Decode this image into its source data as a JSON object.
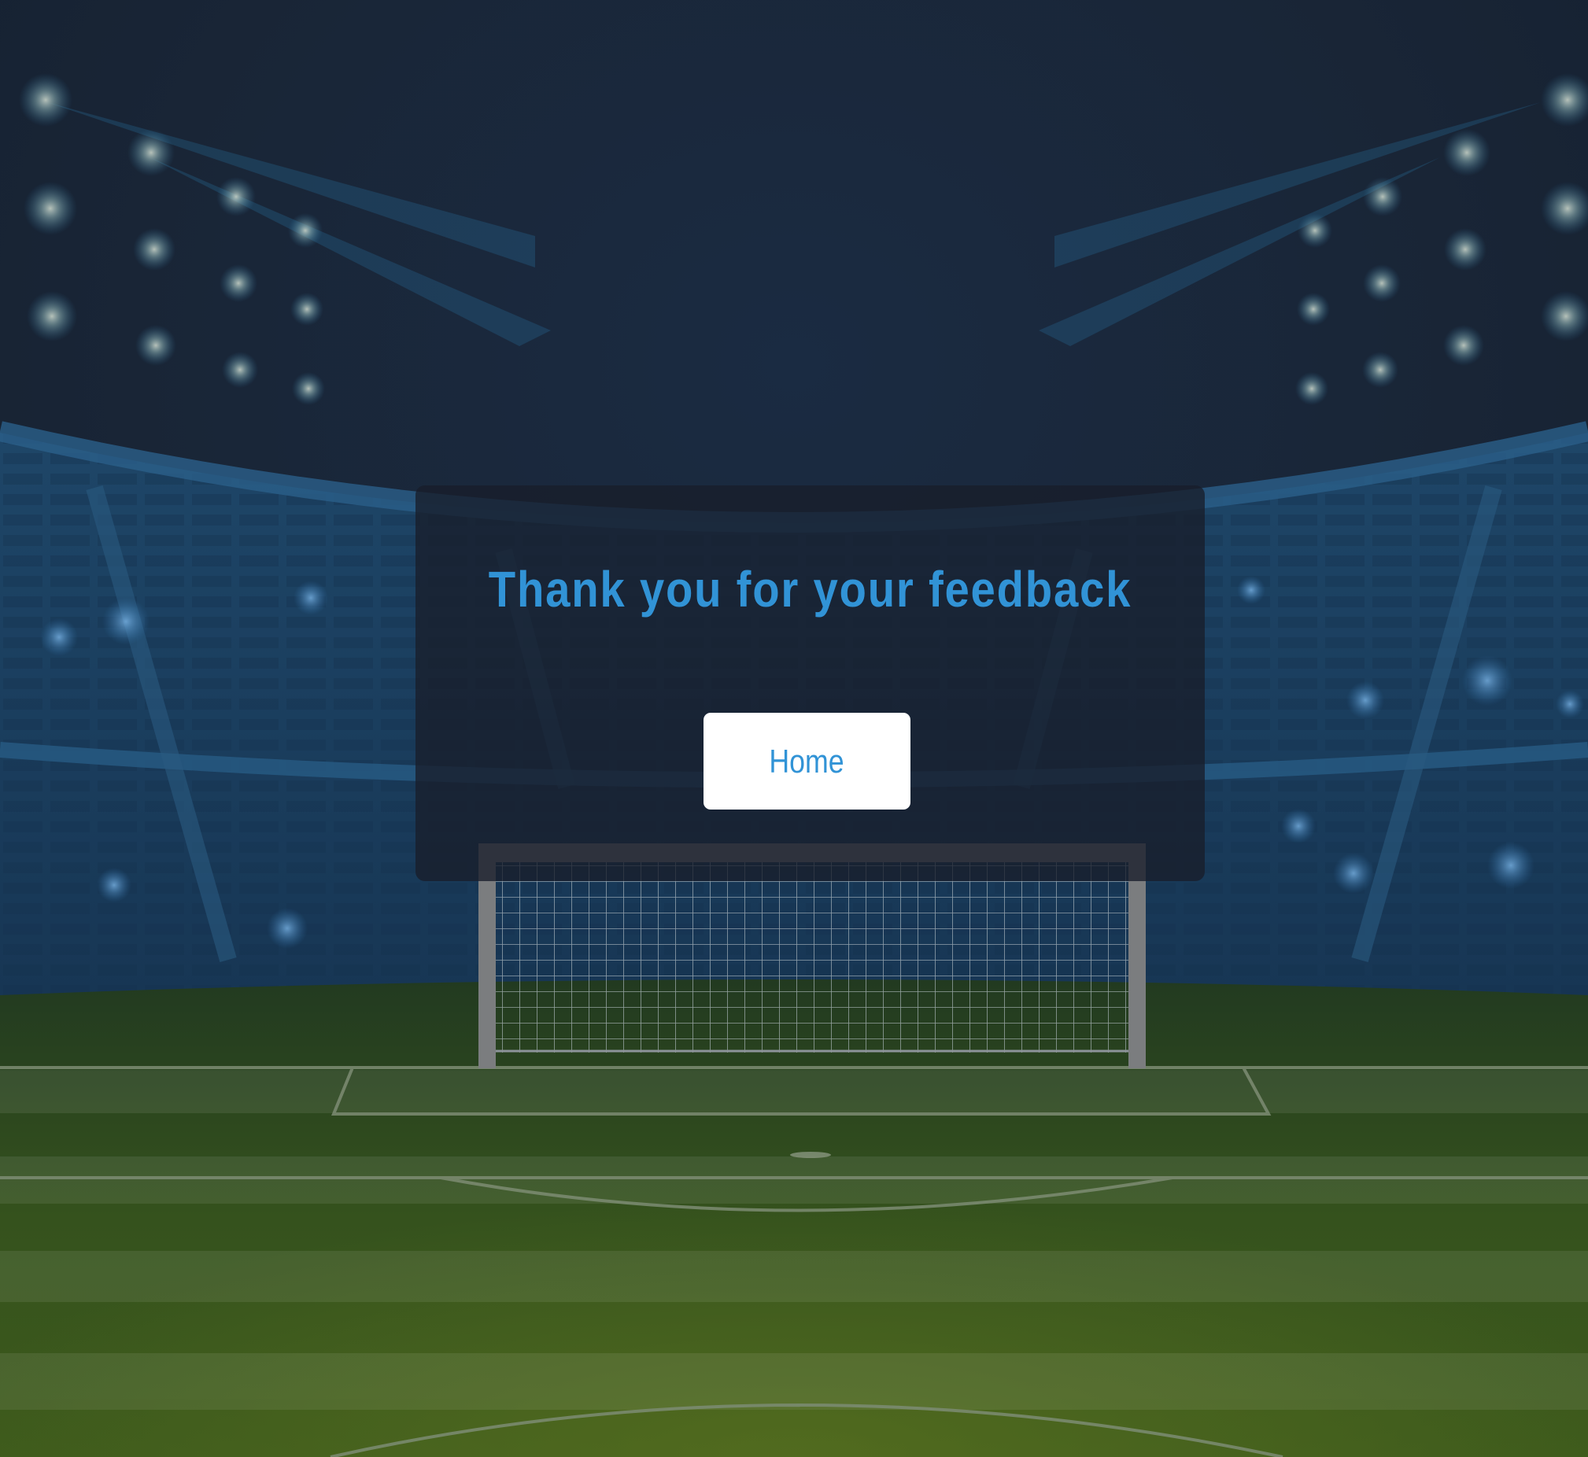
{
  "dialog": {
    "title": "Thank you for your feedback",
    "home_button_label": "Home"
  },
  "background": {
    "description_icon": "stadium-background",
    "colors": {
      "sky": "#1b2738",
      "stand": "#1d4a6e",
      "pitch_dark": "#25401f",
      "pitch_light": "#4a6a1c",
      "accent": "#3193d6"
    }
  }
}
